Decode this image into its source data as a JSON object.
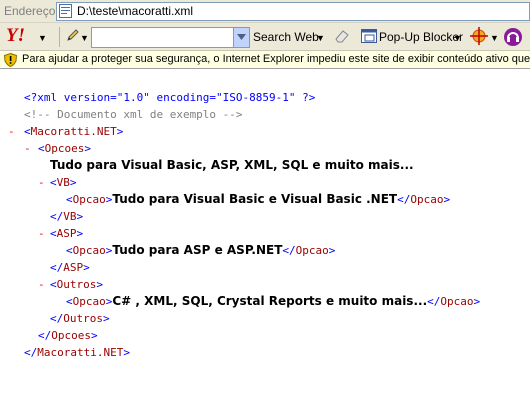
{
  "address_bar": {
    "label": "Endereço",
    "url": "D:\\teste\\macoratti.xml"
  },
  "toolbar": {
    "yahoo_logo": "Y!",
    "search_value": "",
    "search_web_label": "Search Web",
    "popup_blocker_label": "Pop-Up Blocker"
  },
  "infobar": {
    "message": "Para ajudar a proteger sua segurança, o Internet Explorer impediu este site de exibir conteúdo ativo que"
  },
  "xml_view": {
    "declaration": "<?xml version=\"1.0\" encoding=\"ISO-8859-1\" ?>",
    "comment": "<!-- Documento xml de exemplo -->",
    "toggle": "-",
    "root": "Macoratti.NET",
    "opcoes": "Opcoes",
    "opcoes_text": "Tudo para Visual Basic, ASP, XML, SQL e muito mais...",
    "vb": "VB",
    "asp": "ASP",
    "outros": "Outros",
    "opcao": "Opcao",
    "vb_opcao": "Tudo para Visual Basic e Visual Basic .NET",
    "asp_opcao": "Tudo para ASP e ASP.NET",
    "outros_opcao": "C# , XML, SQL, Crystal Reports e muito mais..."
  },
  "colors": {
    "processing_instruction": "#0000ff",
    "comment": "#808080",
    "tag_name": "#990000",
    "bracket": "#0000ff",
    "toggle": "#ff0000"
  },
  "icons": [
    "page-icon",
    "pencil-icon",
    "eraser-icon",
    "popup-blocker-icon",
    "crosshair-icon",
    "headset-icon",
    "shield-warning-icon"
  ]
}
